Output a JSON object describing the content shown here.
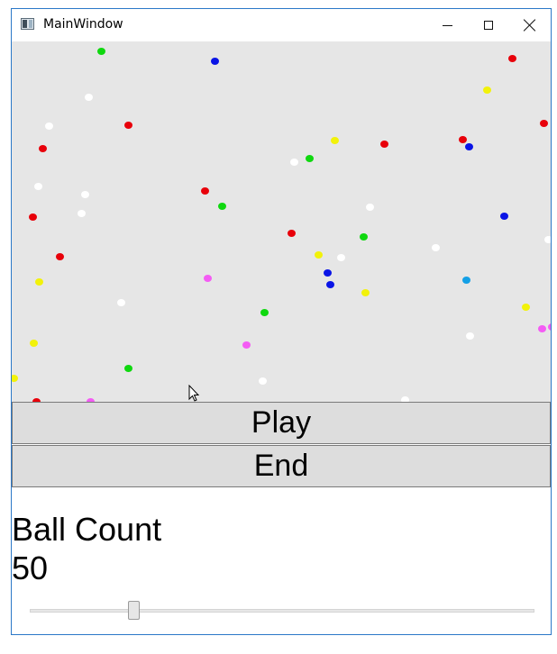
{
  "window": {
    "title": "MainWindow"
  },
  "icons": {
    "app": "app-window-icon",
    "minimize": "minimize-icon",
    "maximize": "maximize-icon",
    "close": "close-icon",
    "cursor": "mouse-cursor-icon"
  },
  "colors": {
    "red": "#e8000a",
    "green": "#0fd80f",
    "blue": "#0a14e6",
    "yellow": "#f2f20a",
    "white": "#ffffff",
    "magenta": "#f45cf4",
    "cyan": "#14a0e6",
    "canvas": "#e6e6e6"
  },
  "buttons": {
    "play": "Play",
    "end": "End"
  },
  "ball_count": {
    "label": "Ball Count",
    "value": "50",
    "slider_min": 0,
    "slider_max": 250,
    "slider_value": 50
  }
}
